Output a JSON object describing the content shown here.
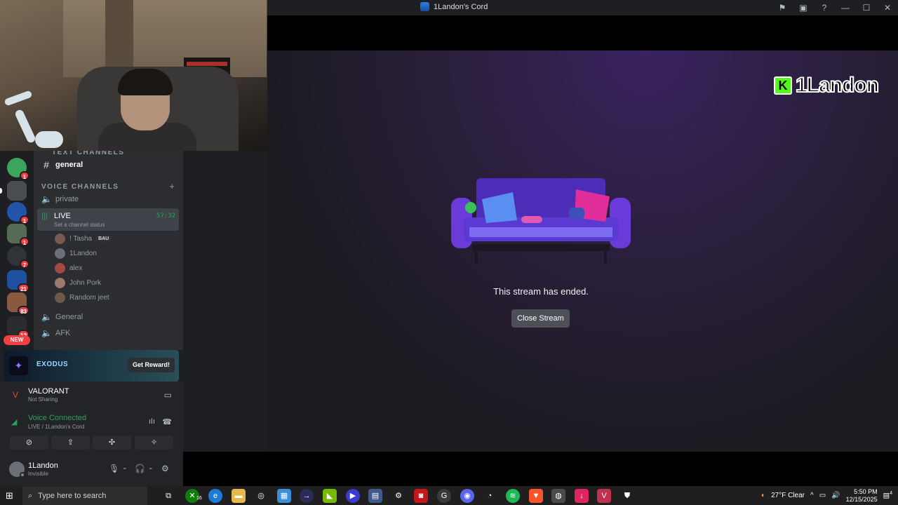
{
  "window": {
    "title": "1Landon's Cord"
  },
  "rail": {
    "badges": [
      "1",
      "1",
      "1",
      "7",
      "21",
      "83",
      "12"
    ],
    "new_tag": "NEW"
  },
  "channels": {
    "text_category": "TEXT CHANNELS",
    "voice_category": "VOICE CHANNELS",
    "general": "general",
    "private": "private",
    "live": {
      "name": "LIVE",
      "status": "Set a channel status",
      "timer": "57:32"
    },
    "users": [
      {
        "name": "! Tasha",
        "tag": "BAU"
      },
      {
        "name": "1Landon"
      },
      {
        "name": "alex"
      },
      {
        "name": "John Pork"
      },
      {
        "name": "Random jeet"
      }
    ],
    "general_voice": "General",
    "afk": "AFK"
  },
  "promo": {
    "brand": "EXODUS",
    "button": "Get Reward!"
  },
  "game": {
    "title": "VALORANT",
    "subtitle": "Not Sharing"
  },
  "voice": {
    "status": "Voice Connected",
    "channel": "LIVE / 1Landon's Cord"
  },
  "user": {
    "name": "1Landon",
    "status": "Invisible"
  },
  "stream": {
    "overlay_name": "1Landon",
    "overlay_logo": "K",
    "ended_text": "This stream has ended.",
    "close_button": "Close Stream"
  },
  "taskbar": {
    "search_placeholder": "Type here to search",
    "weather": "27°F  Clear",
    "time": "5:50 PM",
    "date": "12/15/2025",
    "xbox_badge": "16",
    "notif_count": "4"
  }
}
